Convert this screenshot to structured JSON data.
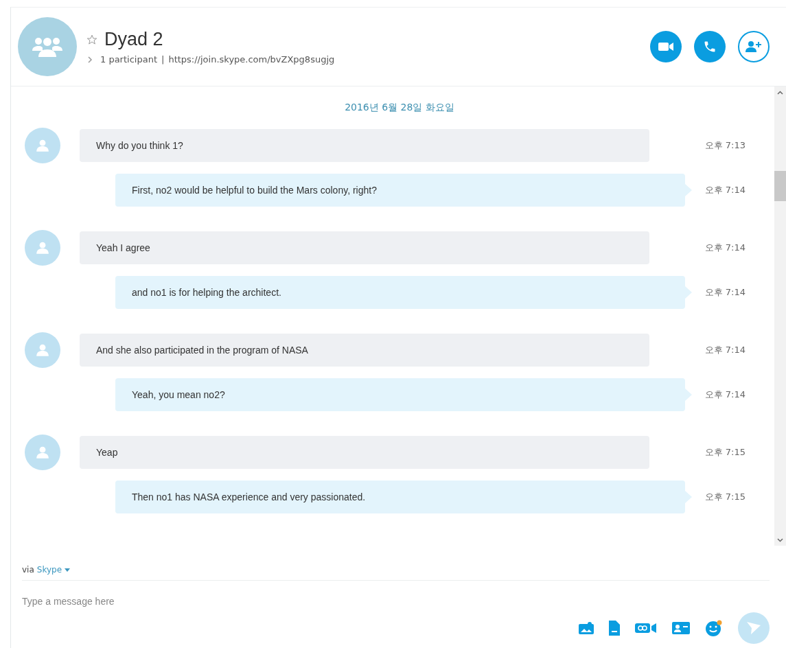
{
  "header": {
    "title": "Dyad 2",
    "favorite": false,
    "participants": "1 participant",
    "separator": "|",
    "link": "https://join.skype.com/bvZXpg8sugjg"
  },
  "date_divider": "2016년 6월 28일 화요일",
  "messages": [
    {
      "kind": "incoming",
      "text": "Why do you think 1?",
      "time": "오후 7:13"
    },
    {
      "kind": "outgoing",
      "text": "First, no2 would be helpful to build the Mars colony, right?",
      "time": "오후 7:14"
    },
    {
      "kind": "incoming",
      "text": "Yeah I agree",
      "time": "오후 7:14"
    },
    {
      "kind": "outgoing",
      "text": "and no1 is for helping the architect.",
      "time": "오후 7:14"
    },
    {
      "kind": "incoming",
      "text": "And she also participated in the program of NASA",
      "time": "오후 7:14"
    },
    {
      "kind": "outgoing",
      "text": "Yeah, you mean no2?",
      "time": "오후 7:14"
    },
    {
      "kind": "incoming",
      "text": "Yeap",
      "time": "오후 7:15"
    },
    {
      "kind": "outgoing",
      "text": "Then no1 has NASA experience and very passionated.",
      "time": "오후 7:15"
    }
  ],
  "composer": {
    "via": "via",
    "service": "Skype",
    "placeholder": "Type a message here"
  }
}
